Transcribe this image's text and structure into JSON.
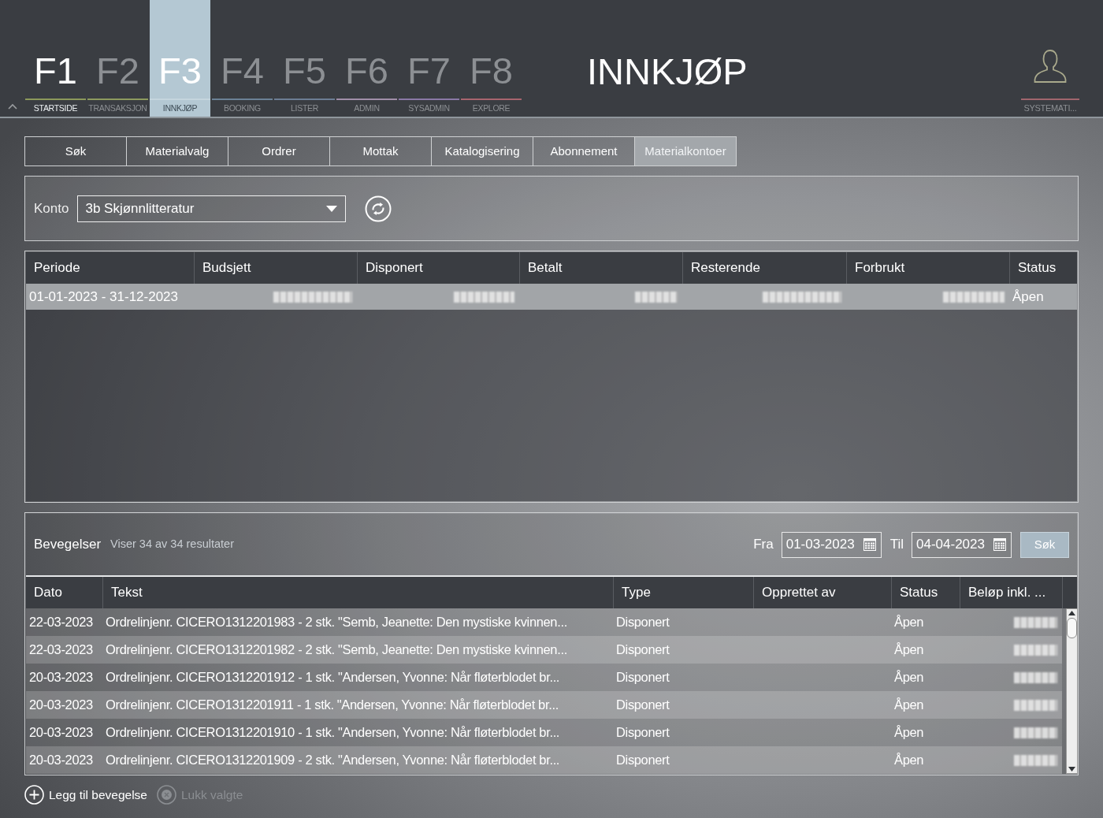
{
  "module_tabs": [
    {
      "key": "F1",
      "label": "STARTSIDE",
      "color": "#8c985a",
      "selected": false,
      "highlighted": true
    },
    {
      "key": "F2",
      "label": "TRANSAKSJON",
      "color": "#8d9a5e",
      "selected": false,
      "highlighted": false
    },
    {
      "key": "F3",
      "label": "INNKJØP",
      "color": "#c5d5dd",
      "selected": true,
      "highlighted": false
    },
    {
      "key": "F4",
      "label": "BOOKING",
      "color": "#6b8196",
      "selected": false,
      "highlighted": false
    },
    {
      "key": "F5",
      "label": "LISTER",
      "color": "#6c7d94",
      "selected": false,
      "highlighted": false
    },
    {
      "key": "F6",
      "label": "ADMIN",
      "color": "#a08ea8",
      "selected": false,
      "highlighted": false
    },
    {
      "key": "F7",
      "label": "SYSADMIN",
      "color": "#8a78a6",
      "selected": false,
      "highlighted": false
    },
    {
      "key": "F8",
      "label": "EXPLORE",
      "color": "#a8646e",
      "selected": false,
      "highlighted": false
    }
  ],
  "module_title": "INNKJØP",
  "user": {
    "label": "SYSTEMATI..."
  },
  "sub_tabs": [
    {
      "label": "Søk",
      "selected": false
    },
    {
      "label": "Materialvalg",
      "selected": false
    },
    {
      "label": "Ordrer",
      "selected": false
    },
    {
      "label": "Mottak",
      "selected": false
    },
    {
      "label": "Katalogisering",
      "selected": false
    },
    {
      "label": "Abonnement",
      "selected": false
    },
    {
      "label": "Materialkontoer",
      "selected": true
    }
  ],
  "account_filter": {
    "label": "Konto",
    "value": "3b Skjønnlitteratur"
  },
  "budget_table": {
    "columns": [
      "Periode",
      "Budsjett",
      "Disponert",
      "Betalt",
      "Resterende",
      "Forbrukt",
      "Status"
    ],
    "rows": [
      {
        "selected": true,
        "cells": [
          {
            "kind": "text",
            "text": "01-01-2023 - 31-12-2023"
          },
          {
            "kind": "redacted"
          },
          {
            "kind": "redacted"
          },
          {
            "kind": "redacted"
          },
          {
            "kind": "redacted"
          },
          {
            "kind": "redacted"
          },
          {
            "kind": "text",
            "text": "Åpen"
          }
        ]
      }
    ]
  },
  "movements": {
    "title": "Bevegelser",
    "result_count": "Viser 34 av 34 resultater",
    "from": {
      "label": "Fra",
      "value": "01-03-2023"
    },
    "to": {
      "label": "Til",
      "value": "04-04-2023"
    },
    "search_button": "Søk",
    "columns": [
      "Dato",
      "Tekst",
      "Type",
      "Opprettet av",
      "Status",
      "Beløp inkl. ..."
    ],
    "rows": [
      {
        "cells": [
          {
            "kind": "text",
            "text": "22-03-2023"
          },
          {
            "kind": "text",
            "text": "Ordrelinjenr. CICERO1312201983 - 2 stk. \"Semb, Jeanette: Den mystiske kvinnen..."
          },
          {
            "kind": "text",
            "text": "Disponert"
          },
          {
            "kind": "empty"
          },
          {
            "kind": "text",
            "text": "Åpen"
          },
          {
            "kind": "redacted"
          }
        ]
      },
      {
        "cells": [
          {
            "kind": "text",
            "text": "22-03-2023"
          },
          {
            "kind": "text",
            "text": "Ordrelinjenr. CICERO1312201982 - 2 stk. \"Semb, Jeanette: Den mystiske kvinnen..."
          },
          {
            "kind": "text",
            "text": "Disponert"
          },
          {
            "kind": "empty"
          },
          {
            "kind": "text",
            "text": "Åpen"
          },
          {
            "kind": "redacted"
          }
        ]
      },
      {
        "cells": [
          {
            "kind": "text",
            "text": "20-03-2023"
          },
          {
            "kind": "text",
            "text": "Ordrelinjenr. CICERO1312201912 - 1 stk. \"Andersen, Yvonne: Når fløterblodet br..."
          },
          {
            "kind": "text",
            "text": "Disponert"
          },
          {
            "kind": "empty"
          },
          {
            "kind": "text",
            "text": "Åpen"
          },
          {
            "kind": "redacted"
          }
        ]
      },
      {
        "cells": [
          {
            "kind": "text",
            "text": "20-03-2023"
          },
          {
            "kind": "text",
            "text": "Ordrelinjenr. CICERO1312201911 - 1 stk. \"Andersen, Yvonne: Når fløterblodet br..."
          },
          {
            "kind": "text",
            "text": "Disponert"
          },
          {
            "kind": "empty"
          },
          {
            "kind": "text",
            "text": "Åpen"
          },
          {
            "kind": "redacted"
          }
        ]
      },
      {
        "cells": [
          {
            "kind": "text",
            "text": "20-03-2023"
          },
          {
            "kind": "text",
            "text": "Ordrelinjenr. CICERO1312201910 - 1 stk. \"Andersen, Yvonne: Når fløterblodet br..."
          },
          {
            "kind": "text",
            "text": "Disponert"
          },
          {
            "kind": "empty"
          },
          {
            "kind": "text",
            "text": "Åpen"
          },
          {
            "kind": "redacted"
          }
        ]
      },
      {
        "cells": [
          {
            "kind": "text",
            "text": "20-03-2023"
          },
          {
            "kind": "text",
            "text": "Ordrelinjenr. CICERO1312201909 - 2 stk. \"Andersen, Yvonne: Når fløterblodet br..."
          },
          {
            "kind": "text",
            "text": "Disponert"
          },
          {
            "kind": "empty"
          },
          {
            "kind": "text",
            "text": "Åpen"
          },
          {
            "kind": "redacted"
          }
        ]
      }
    ]
  },
  "actions": [
    {
      "kind": "add",
      "label": "Legg til bevegelse",
      "disabled": false
    },
    {
      "kind": "close",
      "label": "Lukk valgte",
      "disabled": true
    }
  ]
}
